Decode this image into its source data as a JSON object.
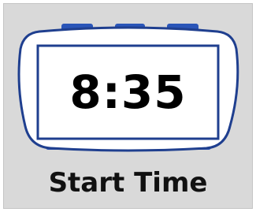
{
  "clock": {
    "time": "8:35",
    "body_color": "#ffffff",
    "outline_color": "#1f3f8f",
    "button_color": "#2a55b8",
    "foot_color": "#2a55b8",
    "icon": "alarm-clock-icon"
  },
  "caption": {
    "label": "Start Time"
  },
  "background": {
    "color": "#d9d9d9"
  }
}
